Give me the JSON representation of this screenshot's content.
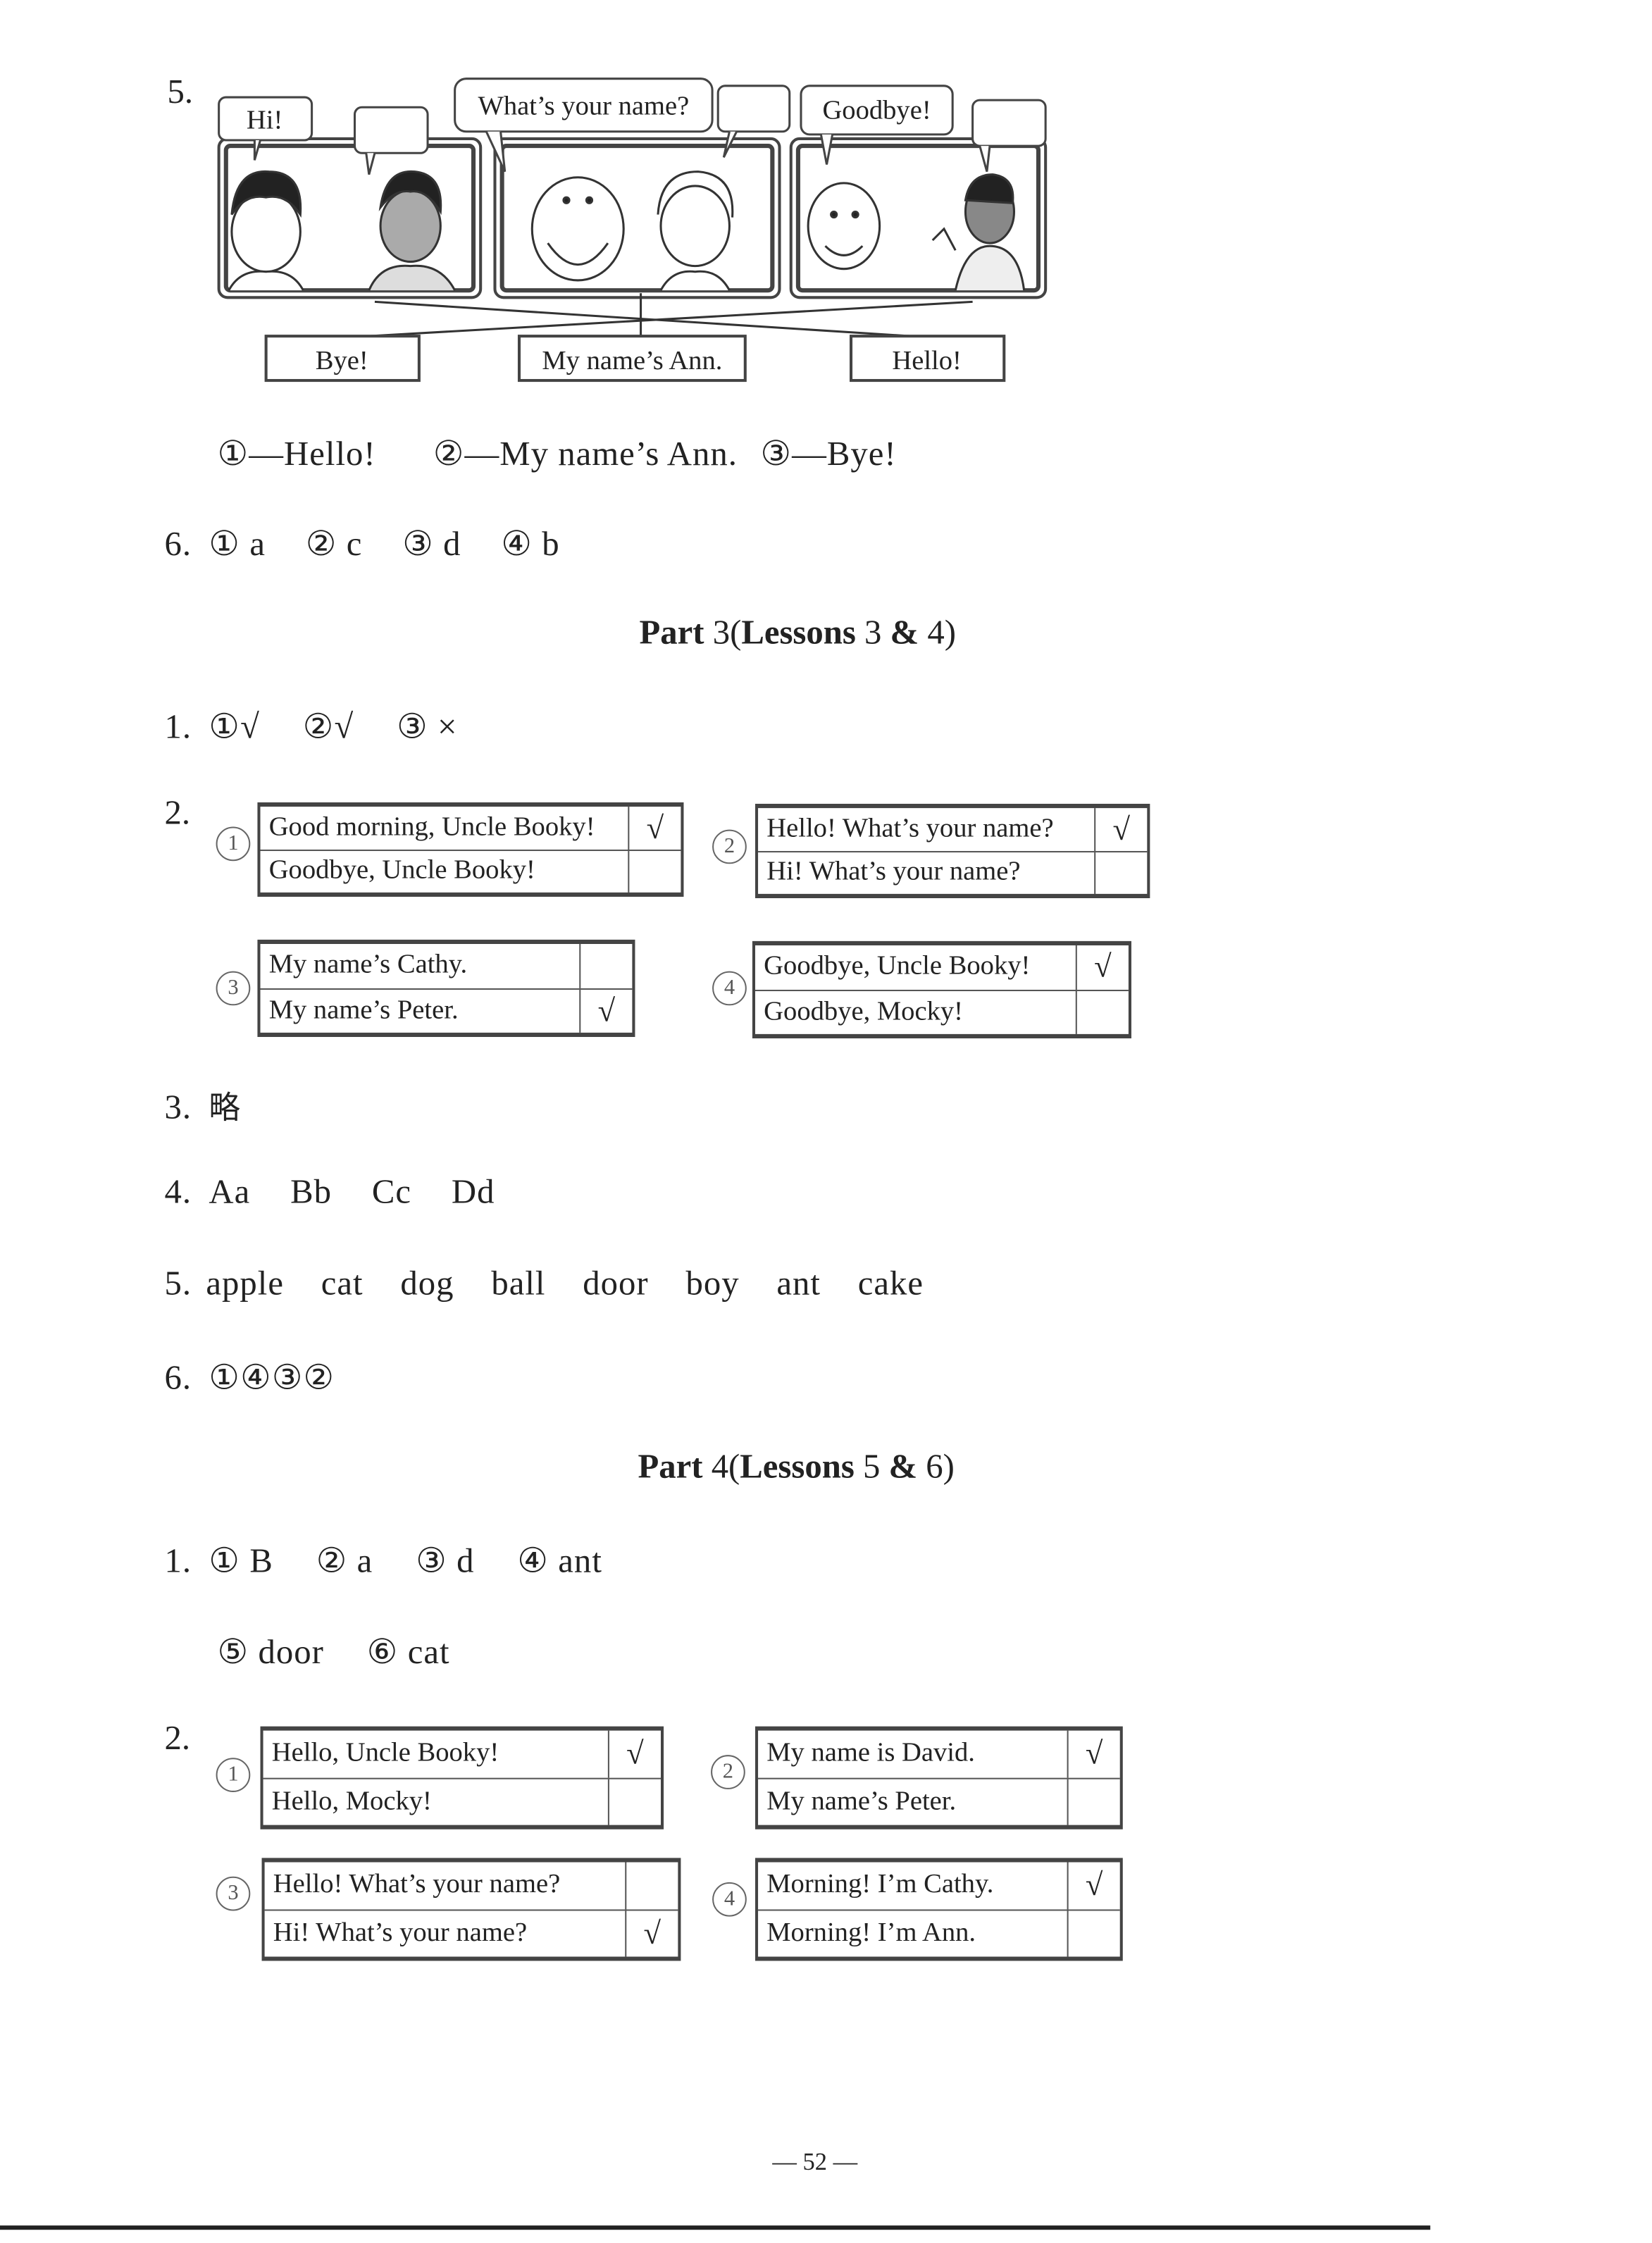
{
  "q5_top": {
    "number": "5.",
    "bubbles": [
      "Hi!",
      "",
      "What’s your name?",
      "",
      "Goodbye!",
      ""
    ],
    "options": [
      "Bye!",
      "My name’s Ann.",
      "Hello!"
    ],
    "answer": [
      "①—Hello!",
      "②—My name’s Ann.",
      "③—Bye!"
    ]
  },
  "q6_top": {
    "number": "6.",
    "answers": [
      "① a",
      "② c",
      "③ d",
      "④ b"
    ]
  },
  "part3": {
    "heading_bold1": "Part",
    "heading_num": "3(",
    "heading_bold2": "Lessons",
    "heading_rest": "3",
    "heading_amp": "&",
    "heading_end": "4)",
    "q1": {
      "number": "1.",
      "answers": [
        "①√",
        "②√",
        "③ ×"
      ]
    },
    "q2": {
      "number": "2.",
      "tables": [
        {
          "circle": "1",
          "rows": [
            {
              "text": "Good morning, Uncle Booky!",
              "mark": "√"
            },
            {
              "text": "Goodbye, Uncle Booky!",
              "mark": ""
            }
          ]
        },
        {
          "circle": "2",
          "rows": [
            {
              "text": "Hello!  What’s your name?",
              "mark": "√"
            },
            {
              "text": "Hi! What’s your name?",
              "mark": ""
            }
          ]
        },
        {
          "circle": "3",
          "rows": [
            {
              "text": "My name’s Cathy.",
              "mark": ""
            },
            {
              "text": "My name’s Peter.",
              "mark": "√"
            }
          ]
        },
        {
          "circle": "4",
          "rows": [
            {
              "text": "Goodbye, Uncle Booky!",
              "mark": "√"
            },
            {
              "text": "Goodbye, Mocky!",
              "mark": ""
            }
          ]
        }
      ]
    },
    "q3": {
      "number": "3.",
      "answer": "略"
    },
    "q4": {
      "number": "4.",
      "answers": [
        "Aa",
        "Bb",
        "Cc",
        "Dd"
      ]
    },
    "q5": {
      "number": "5.",
      "answers": [
        "apple",
        "cat",
        "dog",
        "ball",
        "door",
        "boy",
        "ant",
        "cake"
      ]
    },
    "q6": {
      "number": "6.",
      "answer": "①④③②"
    }
  },
  "part4": {
    "heading_bold1": "Part",
    "heading_num": "4(",
    "heading_bold2": "Lessons",
    "heading_rest": "5",
    "heading_amp": "&",
    "heading_end": "6)",
    "q1": {
      "number": "1.",
      "answers_line1": [
        "① B",
        "② a",
        "③ d",
        "④ ant"
      ],
      "answers_line2": [
        "⑤ door",
        "⑥ cat"
      ]
    },
    "q2": {
      "number": "2.",
      "tables": [
        {
          "circle": "1",
          "rows": [
            {
              "text": "Hello, Uncle Booky!",
              "mark": "√"
            },
            {
              "text": "Hello, Mocky!",
              "mark": ""
            }
          ]
        },
        {
          "circle": "2",
          "rows": [
            {
              "text": "My name is David.",
              "mark": "√"
            },
            {
              "text": "My name’s Peter.",
              "mark": ""
            }
          ]
        },
        {
          "circle": "3",
          "rows": [
            {
              "text": "Hello! What’s your name?",
              "mark": ""
            },
            {
              "text": "Hi! What’s your name?",
              "mark": "√"
            }
          ]
        },
        {
          "circle": "4",
          "rows": [
            {
              "text": "Morning! I’m Cathy.",
              "mark": "√"
            },
            {
              "text": "Morning! I’m Ann.",
              "mark": ""
            }
          ]
        }
      ]
    }
  },
  "footer": {
    "page_number": "— 52 —"
  }
}
